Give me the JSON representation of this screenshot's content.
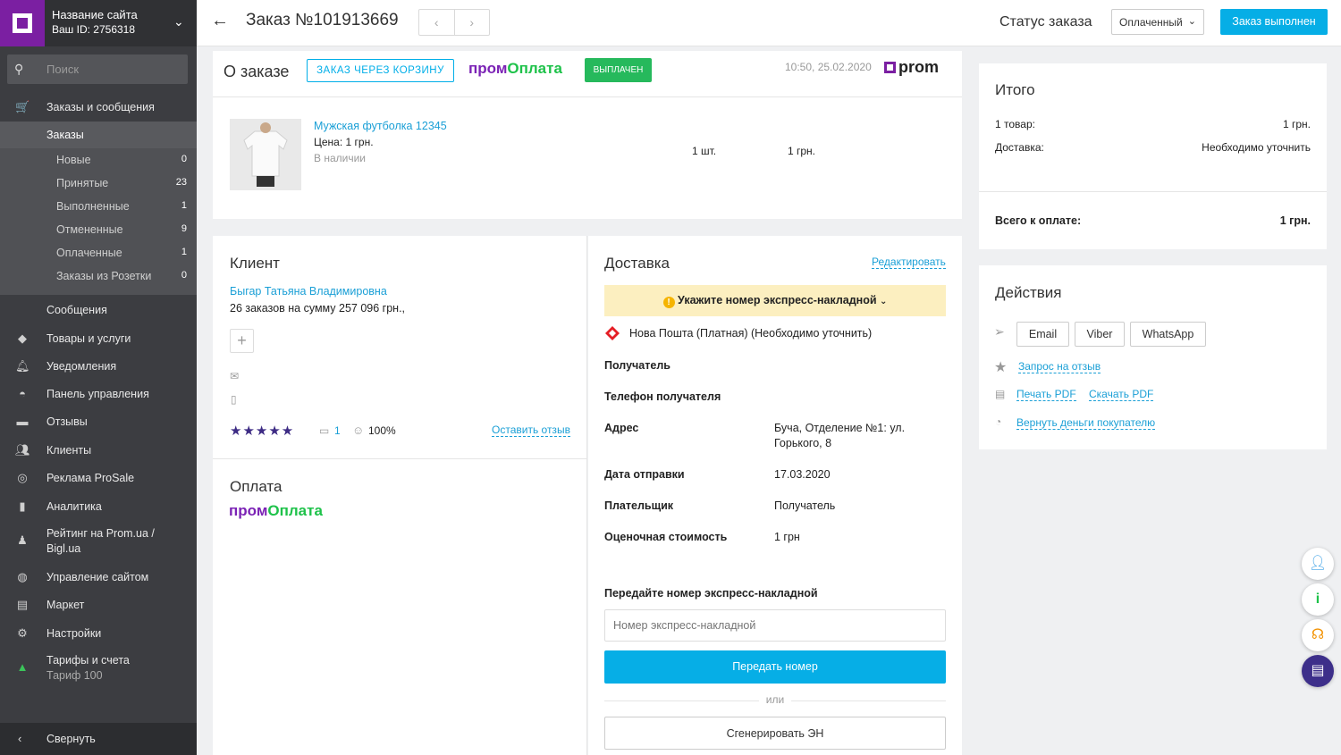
{
  "sidebar": {
    "site_name": "Название сайта",
    "site_id": "Ваш ID: 2756318",
    "search_placeholder": "Поиск",
    "orders_section": "Заказы и сообщения",
    "orders_active": "Заказы",
    "sub_items": [
      {
        "label": "Новые",
        "count": "0"
      },
      {
        "label": "Принятые",
        "count": "23"
      },
      {
        "label": "Выполненные",
        "count": "1"
      },
      {
        "label": "Отмененные",
        "count": "9"
      },
      {
        "label": "Оплаченные",
        "count": "1"
      },
      {
        "label": "Заказы из Розетки",
        "count": "0"
      }
    ],
    "messages": "Сообщения",
    "items": [
      {
        "label": "Товары и услуги",
        "icon": "tag-icon"
      },
      {
        "label": "Уведомления",
        "icon": "bell-icon"
      },
      {
        "label": "Панель управления",
        "icon": "gauge-icon"
      },
      {
        "label": "Отзывы",
        "icon": "comment-icon"
      },
      {
        "label": "Клиенты",
        "icon": "users-icon"
      },
      {
        "label": "Реклама ProSale",
        "icon": "target-icon"
      },
      {
        "label": "Аналитика",
        "icon": "chart-icon"
      }
    ],
    "rating_line1": "Рейтинг на Prom.ua /",
    "rating_line2": "Bigl.ua",
    "site_mgmt": "Управление сайтом",
    "market": "Маркет",
    "settings": "Настройки",
    "tariffs": "Тарифы и счета",
    "tariff_name": "Тариф 100",
    "collapse": "Свернуть"
  },
  "topbar": {
    "title": "Заказ №101913669",
    "status_label": "Статус заказа",
    "status_value": "Оплаченный",
    "done_button": "Заказ выполнен"
  },
  "about": {
    "title": "О заказе",
    "badge_cart": "ЗАКАЗ ЧЕРЕЗ КОРЗИНУ",
    "pay_p1": "пром",
    "pay_p2": "Оплата",
    "badge_paid": "ВЫПЛАЧЕН",
    "datetime": "10:50, 25.02.2020",
    "prom_logo": "prom",
    "product_name": "Мужская футболка 12345",
    "product_price": "Цена: 1 грн.",
    "product_stock": "В наличии",
    "qty": "1 шт.",
    "sum": "1 грн."
  },
  "client": {
    "title": "Клиент",
    "name": "Быгар Татьяна Владимировна",
    "orders": "26 заказов на сумму 257 096 грн.,",
    "reviews_count": "1",
    "rating_percent": "100%",
    "leave_review": "Оставить отзыв"
  },
  "payment": {
    "title": "Оплата",
    "p1": "пром",
    "p2": "Оплата"
  },
  "delivery": {
    "title": "Доставка",
    "edit": "Редактировать",
    "warning": "Укажите номер экспресс-накладной",
    "carrier": "Нова Пошта (Платная) (Необходимо уточнить)",
    "recipient_label": "Получатель",
    "phone_label": "Телефон получателя",
    "address_label": "Адрес",
    "address_line1": "Буча, Отделение №1: ул.",
    "address_line2": "Горького, 8",
    "ship_date_label": "Дата отправки",
    "ship_date": "17.03.2020",
    "payer_label": "Плательщик",
    "payer": "Получатель",
    "value_label": "Оценочная стоимость",
    "value": "1 грн",
    "send_label": "Передайте номер экспресс-накладной",
    "input_placeholder": "Номер экспресс-накладной",
    "send_button": "Передать номер",
    "or": "или",
    "generate_button": "Сгенерировать ЭН"
  },
  "summary": {
    "title": "Итого",
    "items_label": "1 товар:",
    "items_value": "1 грн.",
    "delivery_label": "Доставка:",
    "delivery_value": "Необходимо уточнить",
    "total_label": "Всего к оплате:",
    "total_value": "1 грн."
  },
  "actions": {
    "title": "Действия",
    "email": "Email",
    "viber": "Viber",
    "whatsapp": "WhatsApp",
    "review_request": "Запрос на отзыв",
    "print_pdf": "Печать PDF",
    "download_pdf": "Скачать PDF",
    "refund": "Вернуть деньги покупателю"
  },
  "colors": {
    "accent": "#06aee6",
    "brand": "#7b1fa2",
    "green": "#26b95c",
    "warning_bg": "#fcefc0"
  }
}
